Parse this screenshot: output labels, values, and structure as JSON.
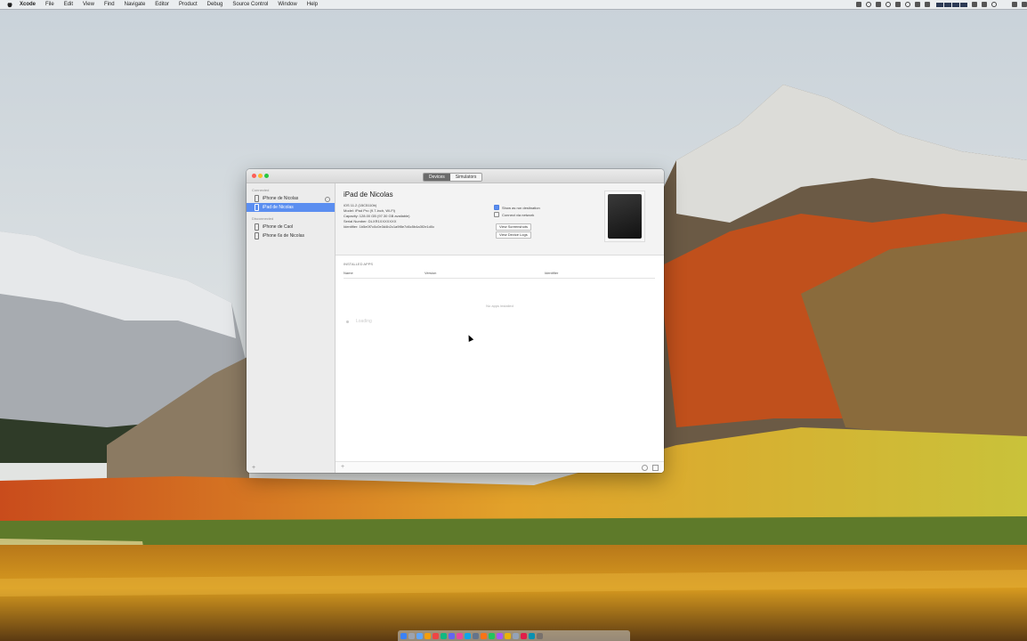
{
  "menubar": {
    "app_name": "Xcode",
    "items": [
      "File",
      "Edit",
      "View",
      "Find",
      "Navigate",
      "Editor",
      "Product",
      "Debug",
      "Source Control",
      "Window",
      "Help"
    ],
    "clock": ""
  },
  "window": {
    "tabs": {
      "devices": "Devices",
      "simulators": "Simulators"
    },
    "sidebar": {
      "section_connected": "Connected",
      "section_disconnected": "Disconnected",
      "connected_items": [
        "iPhone de Nicolas",
        "iPad de Nicolas"
      ],
      "disconnected_items": [
        "iPhone de Caol",
        "iPhone 6s de Nicolas"
      ],
      "add_label": "+"
    },
    "device": {
      "name": "iPad de Nicolas",
      "details": [
        "iOS 11.2 (15C5110b)",
        "Model: iPad Pro (9.7-inch, Wi-Fi)",
        "Capacity: 128.00 GB (97.30 GB available)",
        "Serial Number: DLXR1XXXXXXX",
        "Identifier: 1b5e0f7c0c0e3d4b2c1a9f8e7d6c5b4a3f2e1d0c"
      ],
      "show_as_run_destination": "Show as run destination",
      "connect_via_network": "Connect via network",
      "view_screenshots": "View Screenshots",
      "view_device_logs": "View Device Logs"
    },
    "apps": {
      "title": "INSTALLED APPS",
      "columns": {
        "name": "Name",
        "version": "Version",
        "identifier": "Identifier"
      },
      "empty_text": "No apps installed",
      "loading": "Loading"
    }
  },
  "colors": {
    "accent": "#5b8ef0",
    "traffic_red": "#fc5f57",
    "traffic_yellow": "#fdbc2e",
    "traffic_green": "#28c840"
  }
}
